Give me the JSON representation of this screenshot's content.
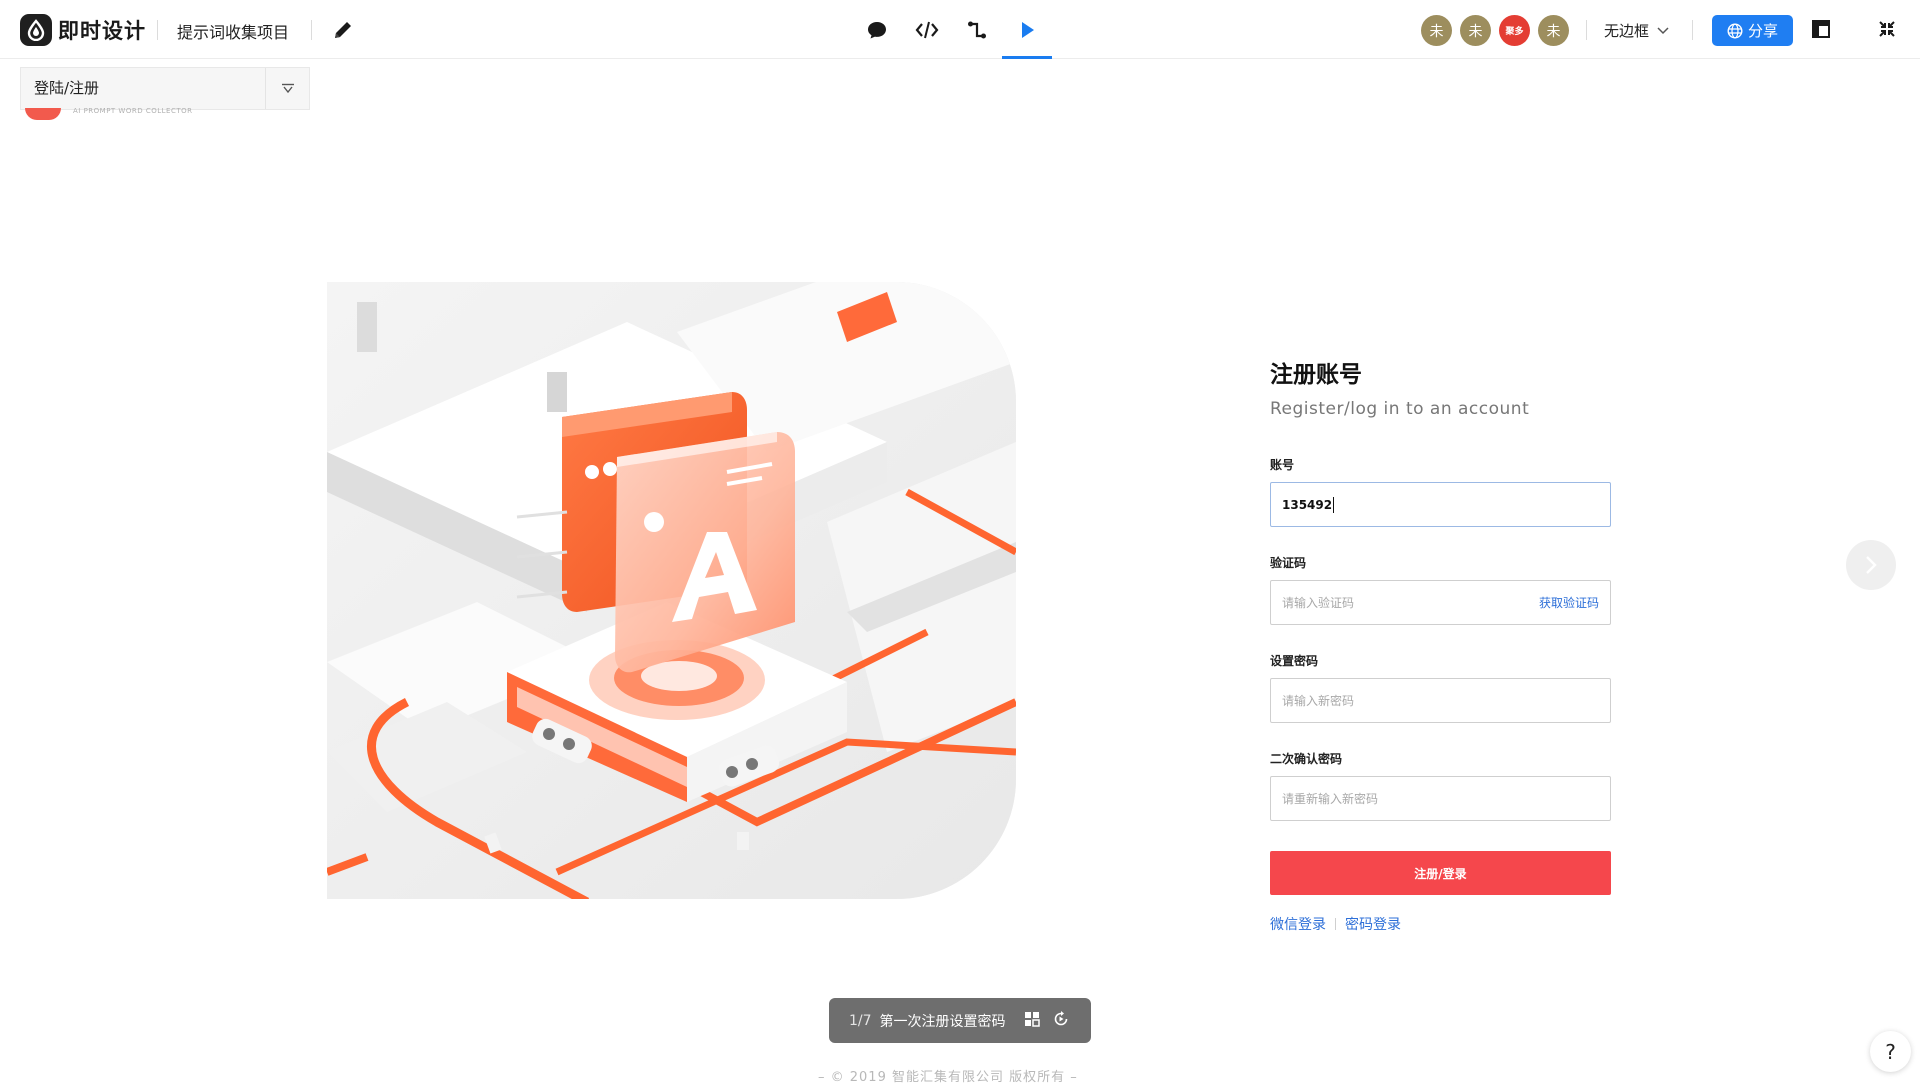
{
  "app": {
    "logo_text": "即时设计",
    "project_name": "提示词收集项目"
  },
  "toolbar": {
    "tools": [
      {
        "id": "comment",
        "icon": "comment-icon"
      },
      {
        "id": "code",
        "icon": "code-icon"
      },
      {
        "id": "connect",
        "icon": "connector-icon"
      },
      {
        "id": "play",
        "icon": "play-icon",
        "active": true
      }
    ],
    "avatars": [
      "未",
      "未",
      "聚多",
      "未"
    ],
    "frame_mode": "无边框",
    "share_label": "分享",
    "accent_color": "#1f7ef2"
  },
  "page_selector": {
    "current": "登陆/注册"
  },
  "brand_peek": {
    "tagline": "AI PROMPT WORD COLLECTOR"
  },
  "form": {
    "title": "注册账号",
    "subtitle": "Register/log in to an account",
    "account_label": "账号",
    "account_value": "135492",
    "code_label": "验证码",
    "code_placeholder": "请输入验证码",
    "get_code": "获取验证码",
    "password_label": "设置密码",
    "password_placeholder": "请输入新密码",
    "confirm_label": "二次确认密码",
    "confirm_placeholder": "请重新输入新密码",
    "submit": "注册/登录",
    "wechat_login": "微信登录",
    "password_login": "密码登录",
    "submit_color": "#f5474c"
  },
  "step_bar": {
    "count": "1/7",
    "title": "第一次注册设置密码"
  },
  "footer": {
    "copyright": "– © 2019 智能汇集有限公司 版权所有 –"
  },
  "help": {
    "label": "?"
  }
}
